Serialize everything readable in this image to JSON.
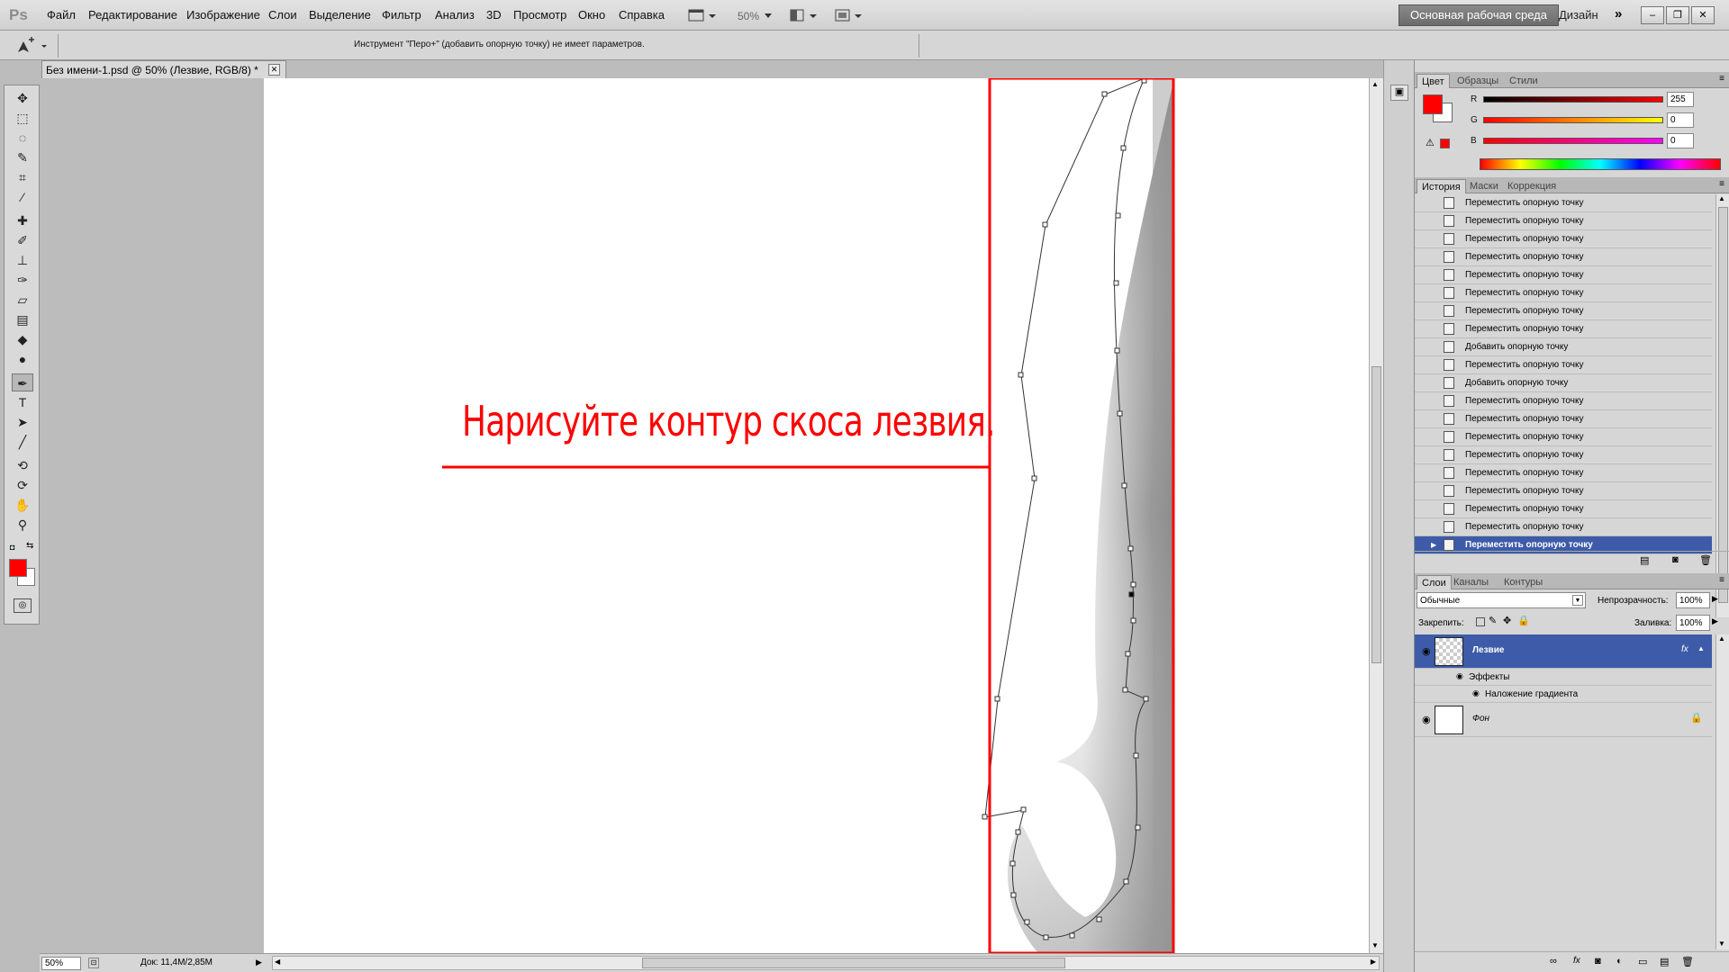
{
  "app": {
    "logo": "Ps"
  },
  "menu": [
    "Файл",
    "Редактирование",
    "Изображение",
    "Слои",
    "Выделение",
    "Фильтр",
    "Анализ",
    "3D",
    "Просмотр",
    "Окно",
    "Справка"
  ],
  "appbar": {
    "zoom": "50%",
    "workspace": "Основная рабочая среда",
    "design": "Дизайн"
  },
  "options": {
    "hint": "Инструмент \"Перо+\" (добавить опорную точку) не имеет параметров."
  },
  "document": {
    "tab_title": "Без имени-1.psd @ 50% (Лезвие, RGB/8) *"
  },
  "canvas": {
    "annotation": "Нарисуйте контур скоса лезвия."
  },
  "status": {
    "zoom": "50%",
    "doc_info": "Док: 11,4M/2,85M"
  },
  "color_panel": {
    "tabs": [
      "Цвет",
      "Образцы",
      "Стили"
    ],
    "channels": [
      {
        "label": "R",
        "value": "255"
      },
      {
        "label": "G",
        "value": "0"
      },
      {
        "label": "B",
        "value": "0"
      }
    ],
    "foreground": "#ff0000"
  },
  "history_panel": {
    "tabs": [
      "История",
      "Маски",
      "Коррекция"
    ],
    "items": [
      "Переместить опорную точку",
      "Переместить опорную точку",
      "Переместить опорную точку",
      "Переместить опорную точку",
      "Переместить опорную точку",
      "Переместить опорную точку",
      "Переместить опорную точку",
      "Переместить опорную точку",
      "Добавить опорную точку",
      "Переместить опорную точку",
      "Добавить опорную точку",
      "Переместить опорную точку",
      "Переместить опорную точку",
      "Переместить опорную точку",
      "Переместить опорную точку",
      "Переместить опорную точку",
      "Переместить опорную точку",
      "Переместить опорную точку",
      "Переместить опорную точку",
      "Переместить опорную точку"
    ]
  },
  "layers_panel": {
    "tabs": [
      "Слои",
      "Каналы",
      "Контуры"
    ],
    "blend_mode": "Обычные",
    "opacity_label": "Непрозрачность:",
    "opacity": "100%",
    "lock_label": "Закрепить:",
    "fill_label": "Заливка:",
    "fill": "100%",
    "layer_main": "Лезвие",
    "effects_label": "Эффекты",
    "effect_item": "Наложение градиента",
    "layer_bg": "Фон"
  }
}
